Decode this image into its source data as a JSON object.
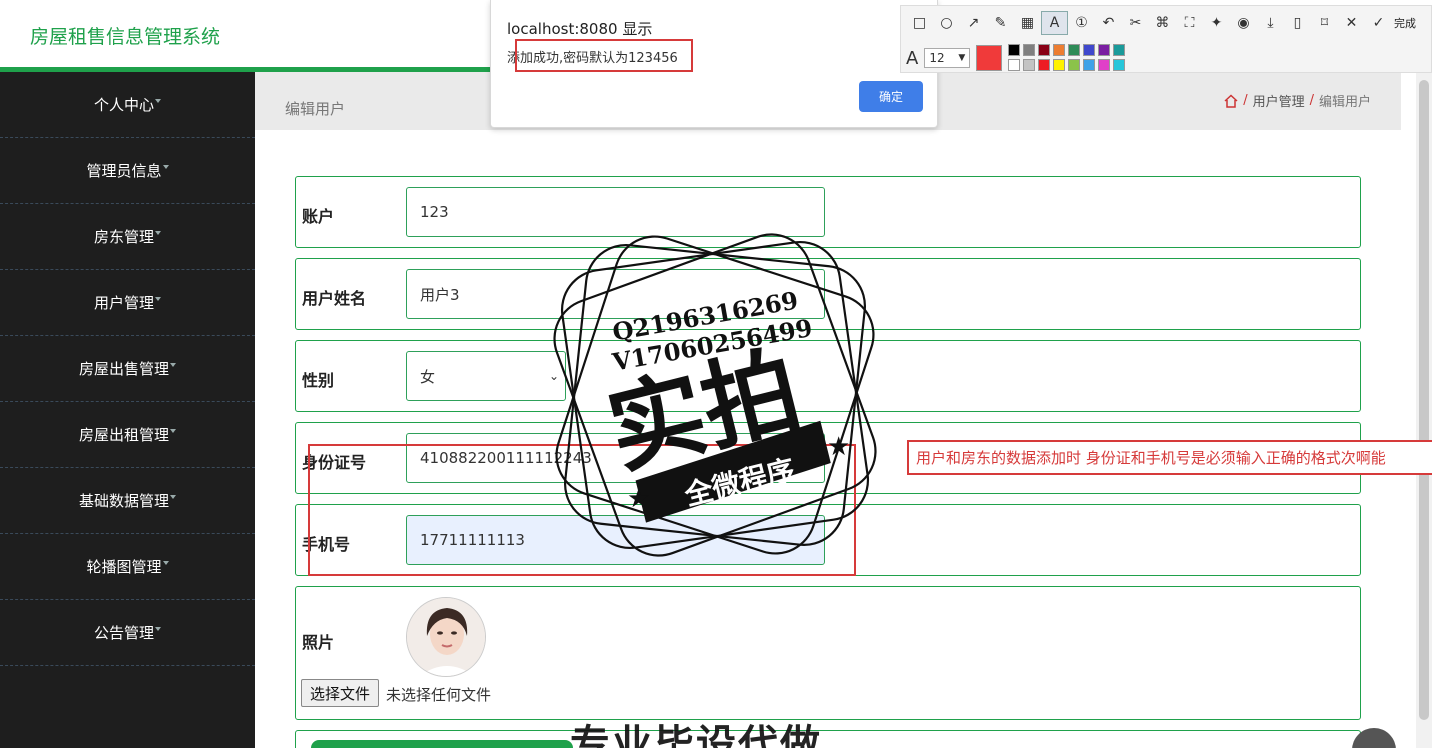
{
  "header": {
    "brand": "房屋租售信息管理系统"
  },
  "sidebar": {
    "items": [
      {
        "label": "个人中心"
      },
      {
        "label": "管理员信息"
      },
      {
        "label": "房东管理"
      },
      {
        "label": "用户管理"
      },
      {
        "label": "房屋出售管理"
      },
      {
        "label": "房屋出租管理"
      },
      {
        "label": "基础数据管理"
      },
      {
        "label": "轮播图管理"
      },
      {
        "label": "公告管理"
      }
    ]
  },
  "breadcrumb": {
    "title": "编辑用户",
    "path": [
      "用户管理",
      "编辑用户"
    ]
  },
  "form": {
    "account_label": "账户",
    "account_value": "123",
    "name_label": "用户姓名",
    "name_value": "用户3",
    "gender_label": "性别",
    "gender_value": "女",
    "idcard_label": "身份证号",
    "idcard_value": "410882200111112243",
    "phone_label": "手机号",
    "phone_value": "17711111113",
    "photo_label": "照片",
    "file_button": "选择文件",
    "file_status": "未选择任何文件"
  },
  "dialog": {
    "title": "localhost:8080 显示",
    "message": "添加成功,密码默认为123456",
    "ok": "确定"
  },
  "toolbar": {
    "font_size": "12",
    "done": "完成",
    "current_color": "#f03a3a"
  },
  "annotation": {
    "note": "用户和房东的数据添加时 身份证和手机号是必须输入正确的格式次啊能"
  },
  "watermark": {
    "qq": "Q2196316269",
    "vx": "V17060256499",
    "big": "实拍",
    "band": "全微程序",
    "bottom": "专业毕设代做"
  },
  "colors": {
    "brand_green": "#1fa14b",
    "sidebar_bg": "#1e1e1e",
    "annotation_red": "#d63a3a",
    "ok_blue": "#3f7ee8"
  }
}
